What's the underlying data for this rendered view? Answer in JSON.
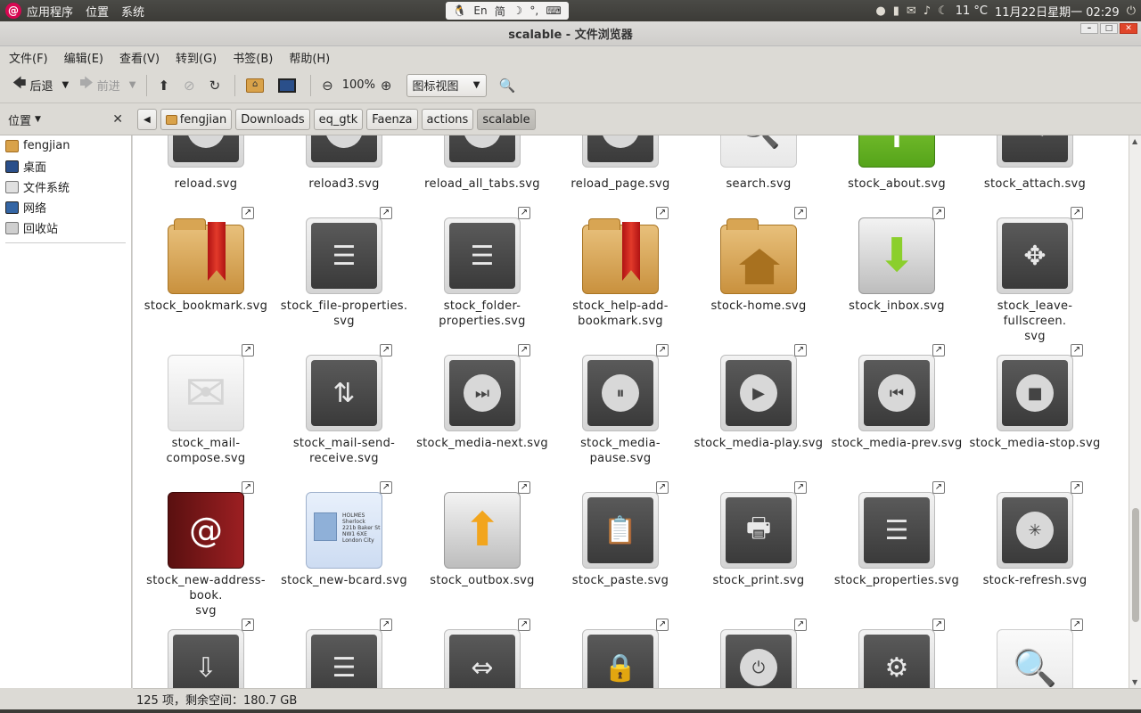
{
  "panel": {
    "menus": [
      "应用程序",
      "位置",
      "系统"
    ],
    "input": {
      "en": "En",
      "simp": "简"
    },
    "temp": "11 °C",
    "datetime": "11月22日星期一 02:29"
  },
  "window": {
    "title": "scalable - 文件浏览器"
  },
  "menubar": [
    "文件(F)",
    "编辑(E)",
    "查看(V)",
    "转到(G)",
    "书签(B)",
    "帮助(H)"
  ],
  "toolbar": {
    "back": "后退",
    "forward": "前进",
    "zoom": "100%",
    "view": "图标视图"
  },
  "sidebar": {
    "header": "位置",
    "items": [
      "fengjian",
      "桌面",
      "文件系统",
      "网络",
      "回收站"
    ]
  },
  "breadcrumbs": [
    "fengjian",
    "Downloads",
    "eq_gtk",
    "Faenza",
    "actions",
    "scalable"
  ],
  "files": [
    {
      "name": "reload.svg",
      "type": "dark",
      "glyph": "✳"
    },
    {
      "name": "reload3.svg",
      "type": "dark",
      "glyph": "✳"
    },
    {
      "name": "reload_all_tabs.svg",
      "type": "dark",
      "glyph": "✳"
    },
    {
      "name": "reload_page.svg",
      "type": "dark",
      "glyph": "✳"
    },
    {
      "name": "search.svg",
      "type": "paper",
      "glyph": "🔍"
    },
    {
      "name": "stock_about.svg",
      "type": "green",
      "glyph": "i"
    },
    {
      "name": "stock_attach.svg",
      "type": "dark",
      "glyph": "✎"
    },
    {
      "name": "stock_bookmark.svg",
      "type": "bookmark"
    },
    {
      "name": "stock_file-properties.svg",
      "type": "dark",
      "glyph": "☰"
    },
    {
      "name": "stock_folder-properties.svg",
      "type": "dark",
      "glyph": "☰"
    },
    {
      "name": "stock_help-add-bookmark.svg",
      "type": "bookmark"
    },
    {
      "name": "stock-home.svg",
      "type": "home"
    },
    {
      "name": "stock_inbox.svg",
      "type": "inbox",
      "glyph": "⬇"
    },
    {
      "name": "stock_leave-fullscreen.svg",
      "type": "dark",
      "glyph": "✥"
    },
    {
      "name": "stock_mail-compose.svg",
      "type": "mail",
      "glyph": "✉"
    },
    {
      "name": "stock_mail-send-receive.svg",
      "type": "dark",
      "glyph": "⇅"
    },
    {
      "name": "stock_media-next.svg",
      "type": "dark",
      "glyph": "⏭"
    },
    {
      "name": "stock_media-pause.svg",
      "type": "dark",
      "glyph": "⏸"
    },
    {
      "name": "stock_media-play.svg",
      "type": "dark",
      "glyph": "▶"
    },
    {
      "name": "stock_media-prev.svg",
      "type": "dark",
      "glyph": "⏮"
    },
    {
      "name": "stock_media-stop.svg",
      "type": "dark",
      "glyph": "■"
    },
    {
      "name": "stock_new-address-book.svg",
      "type": "addrbook",
      "glyph": "@"
    },
    {
      "name": "stock_new-bcard.svg",
      "type": "bcard",
      "lines": [
        "HOLMES",
        "Sherlock",
        "221b Baker St",
        "NW1 6XE",
        "London City"
      ]
    },
    {
      "name": "stock_outbox.svg",
      "type": "outbox",
      "glyph": "⬆"
    },
    {
      "name": "stock_paste.svg",
      "type": "dark",
      "glyph": "📋"
    },
    {
      "name": "stock_print.svg",
      "type": "dark",
      "glyph": "🖶"
    },
    {
      "name": "stock_properties.svg",
      "type": "dark",
      "glyph": "☰"
    },
    {
      "name": "stock-refresh.svg",
      "type": "dark",
      "glyph": "✳"
    },
    {
      "name": "",
      "type": "dark",
      "glyph": "⇩"
    },
    {
      "name": "",
      "type": "dark",
      "glyph": "☰"
    },
    {
      "name": "",
      "type": "dark",
      "glyph": "⇔"
    },
    {
      "name": "",
      "type": "dark",
      "glyph": "🔒"
    },
    {
      "name": "",
      "type": "dark",
      "glyph": "⏻"
    },
    {
      "name": "",
      "type": "dark",
      "glyph": "⚙"
    },
    {
      "name": "",
      "type": "paper",
      "glyph": "🔍"
    }
  ],
  "status": "125 项，剩余空间：180.7 GB"
}
